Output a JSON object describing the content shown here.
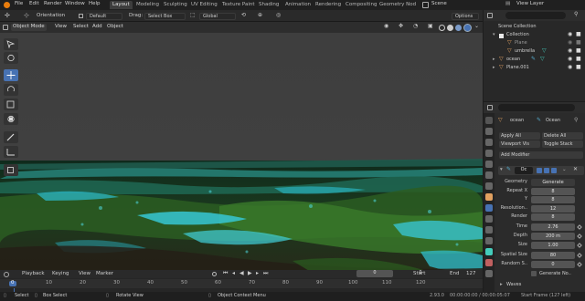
{
  "menubar": {
    "file": "File",
    "edit": "Edit",
    "render": "Render",
    "window": "Window",
    "help": "Help",
    "workspaces": [
      "Layout",
      "Modeling",
      "Sculpting",
      "UV Editing",
      "Texture Paint",
      "Shading",
      "Animation",
      "Rendering",
      "Compositing",
      "Geometry Nod"
    ],
    "scene": "Scene",
    "view_layer": "View Layer"
  },
  "tool_settings": {
    "orientation_label": "Orientation",
    "orientation_value": "Default",
    "drag_label": "Drag:",
    "drag_value": "Select Box",
    "transform_value": "Global",
    "options": "Options"
  },
  "viewport_header": {
    "mode": "Object Mode",
    "view": "View",
    "select": "Select",
    "add": "Add",
    "object": "Object"
  },
  "outliner": {
    "scene_collection": "Scene Collection",
    "items": [
      {
        "label": "Collection"
      },
      {
        "label": "Plane"
      },
      {
        "label": "umbrella"
      },
      {
        "label": "ocean"
      },
      {
        "label": "Plane.001"
      }
    ]
  },
  "properties": {
    "object_name": "ocean",
    "modifier_name": "Ocean",
    "apply_all": "Apply All",
    "delete_all": "Delete All",
    "viewport_vis": "Viewport Vis",
    "toggle_stack": "Toggle Stack",
    "add_modifier": "Add Modifier",
    "modifier_short": "Oc",
    "rows": [
      {
        "label": "Geometry",
        "value": "Generate"
      },
      {
        "label": "Repeat X",
        "value": "8"
      },
      {
        "label": "Y",
        "value": "8"
      },
      {
        "label": "Resolution..",
        "value": "12"
      },
      {
        "label": "Render",
        "value": "8"
      },
      {
        "label": "Time",
        "value": "2.76"
      },
      {
        "label": "Depth",
        "value": "200 m"
      },
      {
        "label": "Size",
        "value": "1.00"
      },
      {
        "label": "Spatial Size",
        "value": "80"
      },
      {
        "label": "Random S..",
        "value": "0"
      }
    ],
    "generate_normals": "Generate No..",
    "waves": "Waves"
  },
  "timeline": {
    "playback": "Playback",
    "keying": "Keying",
    "view": "View",
    "marker": "Marker",
    "current_frame": "0",
    "start_label": "Start",
    "start_value": "0",
    "end_label": "End",
    "end_value": "127",
    "ruler": [
      "0",
      "10",
      "20",
      "30",
      "40",
      "50",
      "60",
      "70",
      "80",
      "90",
      "100",
      "110",
      "120"
    ]
  },
  "statusbar": {
    "select": "Select",
    "box_select": "Box Select",
    "rotate_view": "Rotate View",
    "context_menu": "Object Context Menu",
    "version": "2.93.0",
    "timecode": "00:00:00:00 / 00:00:05:07",
    "start_frame": "Start Frame (127 left)"
  },
  "colors": {
    "accent": "#4772b3",
    "active_tab": "#3d3d3d",
    "ocean_teal": "#2fb7c4",
    "ocean_green": "#3d7a2a"
  }
}
